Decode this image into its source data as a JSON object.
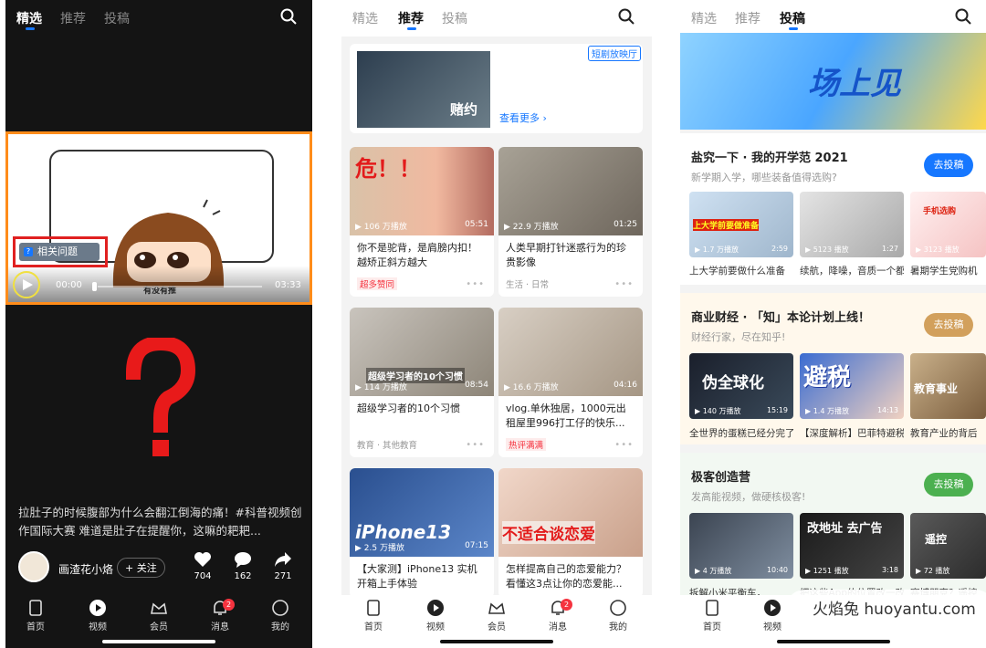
{
  "tabs": {
    "t1": "精选",
    "t2": "推荐",
    "t3": "投稿"
  },
  "p1": {
    "video_label": "有没有推",
    "related_label": "相关问题",
    "time_current": "00:00",
    "time_total": "03:33",
    "caption": "拉肚子的时候腹部为什么会翻江倒海的痛！#科普视频创作国际大赛 难道是肚子在提醒你，这嘛的耙耙...",
    "author": "画渣花小烙",
    "follow": "+ 关注",
    "likes": "704",
    "comments": "162",
    "shares": "271"
  },
  "nav": {
    "home": "首页",
    "video": "视频",
    "vip": "会员",
    "msg": "消息",
    "me": "我的",
    "msg_badge": "2"
  },
  "p2": {
    "banner_tag": "短剧放映厅",
    "banner_more": "查看更多 ›",
    "banner_show": "赌约",
    "cards": [
      {
        "title": "你不是驼背，是肩膀内扣！越矫正斜方越大",
        "views": "▶ 106 万播放",
        "dur": "05:51",
        "tag": "超多赞同",
        "overlay": "危！！"
      },
      {
        "title": "人类早期打针迷惑行为的珍贵影像",
        "views": "▶ 22.9 万播放",
        "dur": "01:25",
        "tag": "生活 · 日常",
        "overlay": ""
      },
      {
        "title": "超级学习者的10个习惯",
        "views": "▶ 114 万播放",
        "dur": "08:54",
        "tag": "教育 · 其他教育",
        "overlay": "超级学习者的10个习惯"
      },
      {
        "title": "vlog.单休独居，1000元出租屋里996打工仔的快乐...",
        "views": "▶ 16.6 万播放",
        "dur": "04:16",
        "tag": "热评满满",
        "overlay": ""
      },
      {
        "title": "【大家测】iPhone13 实机开箱上手体验",
        "views": "▶ 2.5 万播放",
        "dur": "07:15",
        "tag": "",
        "overlay": "iPhone13"
      },
      {
        "title": "怎样提高自己的恋爱能力？看懂这3点让你的恋爱能...",
        "views": "",
        "dur": "",
        "tag": "",
        "overlay": "不适合谈恋爱"
      }
    ]
  },
  "p3": {
    "banner_text": "场上见",
    "post_btn": "去投稿",
    "sections": [
      {
        "title": "盐究一下 · 我的开学范 2021",
        "sub": "新学期入学，哪些装备值得选购?",
        "items": [
          {
            "views": "▶ 1.7 万播放",
            "dur": "2:59",
            "cap": "上大学前要做什么准备",
            "overlay": "上大学前要做准备"
          },
          {
            "views": "▶ 5123 播放",
            "dur": "1:27",
            "cap": "续航，降噪，音质一个都不能少",
            "overlay": ""
          },
          {
            "views": "▶ 3123 播放",
            "dur": "",
            "cap": "暑期学生党购机",
            "overlay": "手机选购"
          }
        ]
      },
      {
        "title": "商业财经 · 「知」本论计划上线！",
        "sub": "财经行家，尽在知乎!",
        "items": [
          {
            "views": "▶ 140 万播放",
            "dur": "15:19",
            "cap": "全世界的蛋糕已经分完了",
            "overlay": "伪全球化"
          },
          {
            "views": "▶ 1.4 万播放",
            "dur": "14:13",
            "cap": "【深度解析】巴菲特避税",
            "overlay": "避税"
          },
          {
            "views": "",
            "dur": "",
            "cap": "教育产业的背后",
            "overlay": "教育事业"
          }
        ]
      },
      {
        "title": "极客创造营",
        "sub": "发高能视频，做硬核极客!",
        "items": [
          {
            "views": "▶ 4 万播放",
            "dur": "10:40",
            "cap": "拆解小米平衡车，",
            "overlay": ""
          },
          {
            "views": "▶ 1251 播放",
            "dur": "3:18",
            "cap": "把这些App的位置改一改",
            "overlay": "改地址 去广告"
          },
          {
            "views": "▶ 72 播放",
            "dur": "",
            "cap": "赛博朋克？遥控",
            "overlay": "遥控"
          }
        ]
      }
    ]
  },
  "watermark": "火焰兔 huoyantu.com",
  "colors": {
    "accent": "#1677ff",
    "highlight_orange": "#ff8c1a",
    "red": "#f5333f",
    "green_btn": "#4cb050",
    "tan_btn": "#d2a05c",
    "blue_btn": "#1677ff"
  }
}
